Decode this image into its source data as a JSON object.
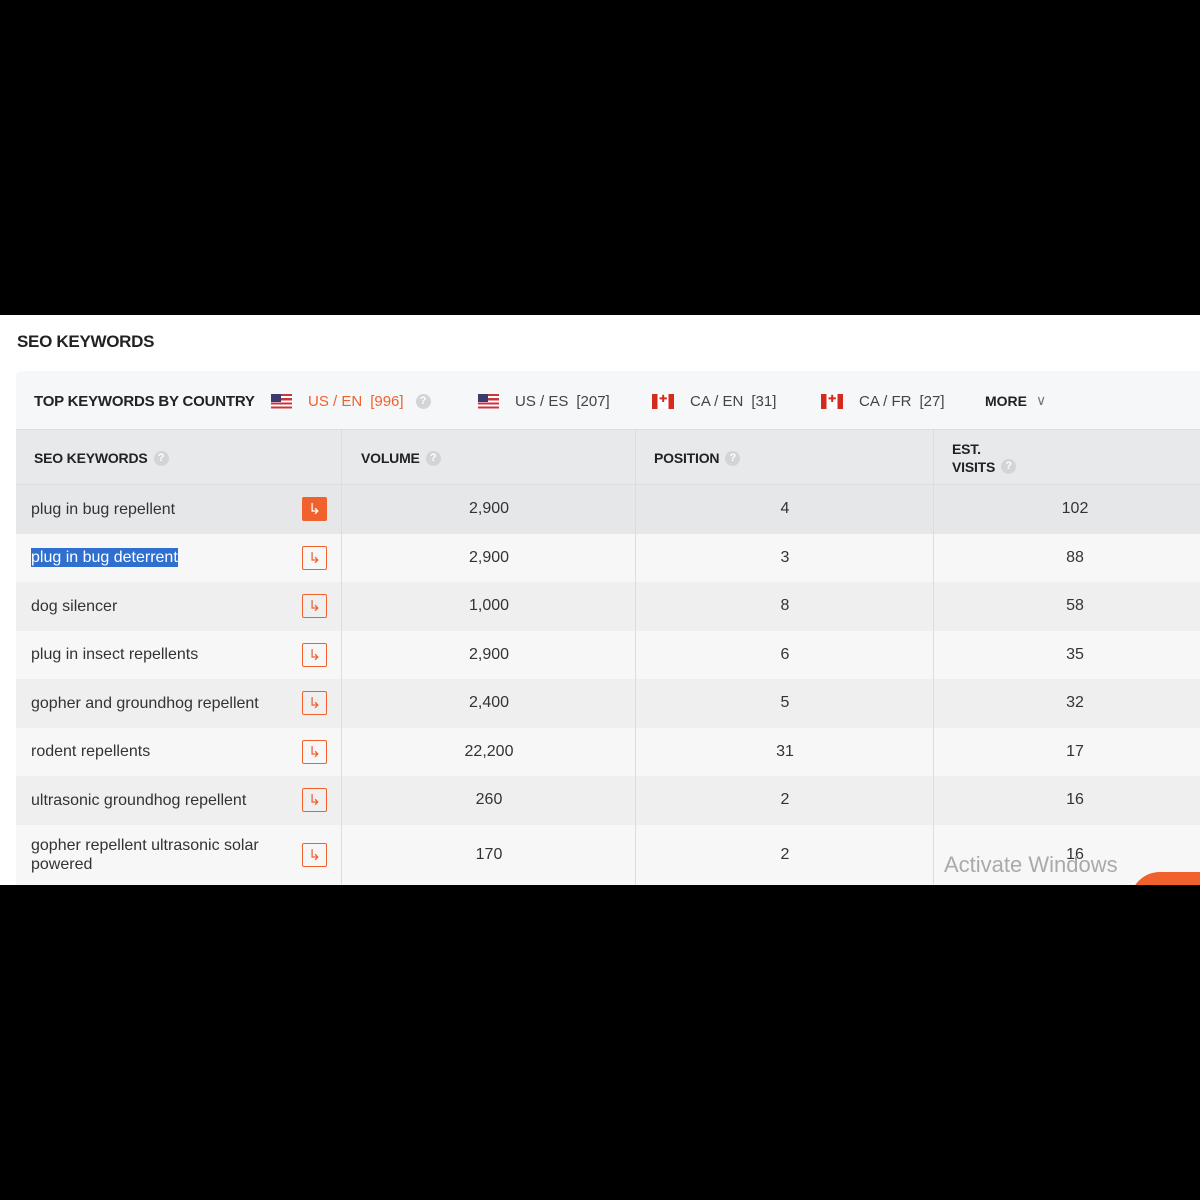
{
  "section_title": "SEO KEYWORDS",
  "country_bar": {
    "label": "TOP KEYWORDS BY COUNTRY",
    "tabs": [
      {
        "flag": "us-flag",
        "name": "US / EN",
        "count": "[996]",
        "active": true
      },
      {
        "flag": "us-flag",
        "name": "US / ES",
        "count": "[207]",
        "active": false
      },
      {
        "flag": "ca-flag",
        "name": "CA / EN",
        "count": "[31]",
        "active": false
      },
      {
        "flag": "ca-flag",
        "name": "CA / FR",
        "count": "[27]",
        "active": false
      }
    ],
    "more_label": "MORE"
  },
  "table": {
    "headers": {
      "keyword": "SEO KEYWORDS",
      "volume": "VOLUME",
      "position": "POSITION",
      "visits_line1": "EST.",
      "visits_line2": "VISITS"
    },
    "rows": [
      {
        "keyword": "plug in bug repellent",
        "volume": "2,900",
        "position": "4",
        "visits": "102"
      },
      {
        "keyword": "plug in bug deterrent",
        "volume": "2,900",
        "position": "3",
        "visits": "88"
      },
      {
        "keyword": "dog silencer",
        "volume": "1,000",
        "position": "8",
        "visits": "58"
      },
      {
        "keyword": "plug in insect repellents",
        "volume": "2,900",
        "position": "6",
        "visits": "35"
      },
      {
        "keyword": "gopher and groundhog repellent",
        "volume": "2,400",
        "position": "5",
        "visits": "32"
      },
      {
        "keyword": "rodent repellents",
        "volume": "22,200",
        "position": "31",
        "visits": "17"
      },
      {
        "keyword": "ultrasonic groundhog repellent",
        "volume": "260",
        "position": "2",
        "visits": "16"
      },
      {
        "keyword": "gopher repellent ultrasonic solar powered",
        "volume": "170",
        "position": "2",
        "visits": "16"
      }
    ]
  },
  "help_glyph": "?",
  "arrow_glyph": "↳",
  "chevron_glyph": "∨",
  "watermark": "Activate Windows",
  "colors": {
    "accent": "#f0612e",
    "selection": "#2f6fcf"
  }
}
